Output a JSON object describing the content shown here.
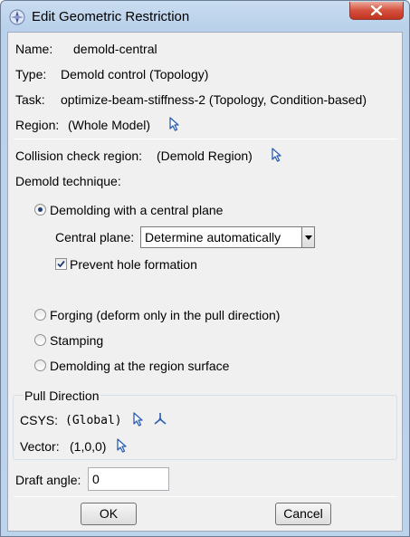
{
  "window": {
    "title": "Edit Geometric Restriction"
  },
  "info": {
    "name_label": "Name:",
    "name_value": "demold-central",
    "type_label": "Type:",
    "type_value": "Demold control (Topology)",
    "task_label": "Task:",
    "task_value": "optimize-beam-stiffness-2 (Topology, Condition-based)",
    "region_label": "Region:",
    "region_value": "(Whole Model)"
  },
  "collision": {
    "label": "Collision check region:",
    "value": "(Demold Region)"
  },
  "demold": {
    "label": "Demold technique:",
    "options": [
      "Demolding with a central plane",
      "Forging (deform only in the pull direction)",
      "Stamping",
      "Demolding at the region surface"
    ],
    "central_plane_label": "Central plane:",
    "central_plane_value": "Determine automatically",
    "prevent_hole_label": "Prevent hole formation",
    "prevent_hole_checked": true
  },
  "pull": {
    "title": "Pull Direction",
    "csys_label": "CSYS:",
    "csys_value": "(Global)",
    "vector_label": "Vector:",
    "vector_value": "(1,0,0)"
  },
  "draft": {
    "label": "Draft angle:",
    "value": "0"
  },
  "buttons": {
    "ok": "OK",
    "cancel": "Cancel"
  }
}
